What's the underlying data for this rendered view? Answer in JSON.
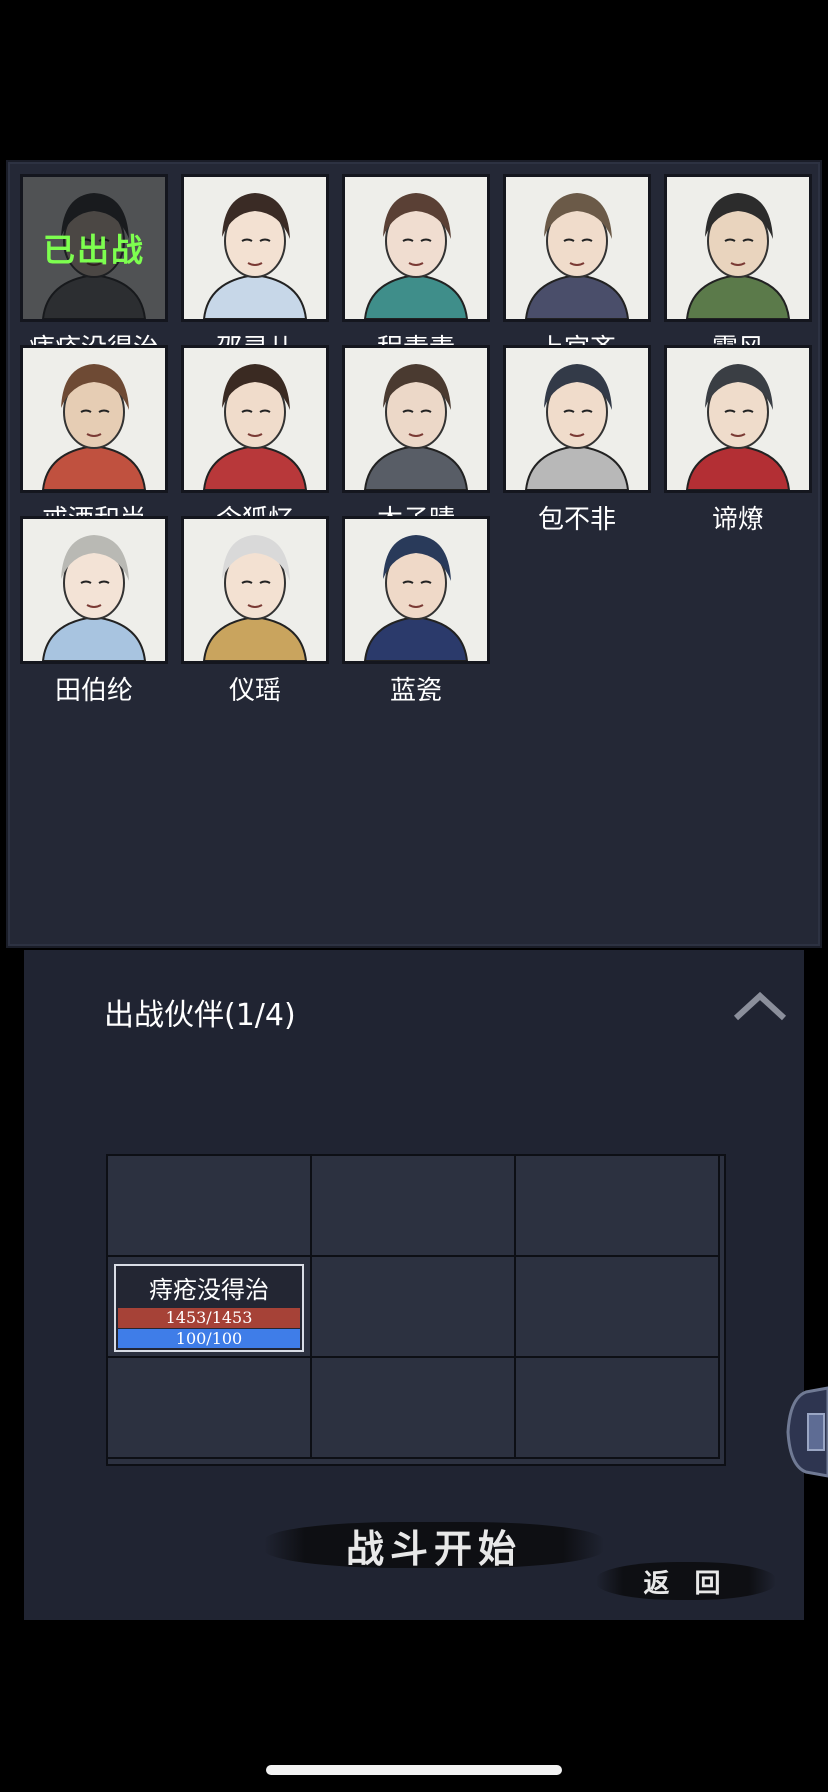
{
  "roster": {
    "deployed_label": "已出战",
    "heroes": [
      {
        "name": "痔疮没得治",
        "deployed": true,
        "skin": "#d9c6b0",
        "hair": "#2a2a2a",
        "cloth": "#6b6b6b"
      },
      {
        "name": "邵灵儿",
        "deployed": false,
        "skin": "#f3e1d2",
        "hair": "#3a2b25",
        "cloth": "#c7d7e8"
      },
      {
        "name": "程素素",
        "deployed": false,
        "skin": "#f0ddd0",
        "hair": "#5a4035",
        "cloth": "#3f8e8a"
      },
      {
        "name": "上官齐",
        "deployed": false,
        "skin": "#f0dccb",
        "hair": "#6b5a48",
        "cloth": "#4a4e6a"
      },
      {
        "name": "霄风",
        "deployed": false,
        "skin": "#e9d4be",
        "hair": "#2c2c2c",
        "cloth": "#5b7a4a"
      },
      {
        "name": "戒酒和尚",
        "deployed": false,
        "skin": "#e6cdb4",
        "hair": "#6e4a34",
        "cloth": "#c0513f"
      },
      {
        "name": "令狐忆",
        "deployed": false,
        "skin": "#f0dccb",
        "hair": "#3a2a22",
        "cloth": "#b8383a"
      },
      {
        "name": "木子晴",
        "deployed": false,
        "skin": "#ecd8c8",
        "hair": "#4a3a30",
        "cloth": "#585d66"
      },
      {
        "name": "包不非",
        "deployed": false,
        "skin": "#f0dccb",
        "hair": "#333a48",
        "cloth": "#b8b8b8"
      },
      {
        "name": "谛燎",
        "deployed": false,
        "skin": "#efdccb",
        "hair": "#3a3e44",
        "cloth": "#b32f34"
      },
      {
        "name": "田伯纶",
        "deployed": false,
        "skin": "#f3e3d6",
        "hair": "#b9b9b4",
        "cloth": "#a8c4e0"
      },
      {
        "name": "仪瑶",
        "deployed": false,
        "skin": "#f3e1d2",
        "hair": "#d9d9d9",
        "cloth": "#c9a45e"
      },
      {
        "name": "蓝瓷",
        "deployed": false,
        "skin": "#efd9c8",
        "hair": "#293a5a",
        "cloth": "#2b3a6b"
      }
    ]
  },
  "party": {
    "title": "出战伙伴(1/4)",
    "slot_unit": {
      "name": "痔疮没得治",
      "hp_text": "1453/1453",
      "mp_text": "100/100"
    }
  },
  "actions": {
    "start_label": "战斗开始",
    "back_label": "返 回"
  },
  "icons": {
    "collapse": "chevron-up-icon",
    "side_tab": "side-menu-tab-icon"
  },
  "colors": {
    "panel": "#242836",
    "deployed_text": "#7dff4f",
    "hp_bar": "#a64237",
    "mp_bar": "#3f7de8"
  }
}
